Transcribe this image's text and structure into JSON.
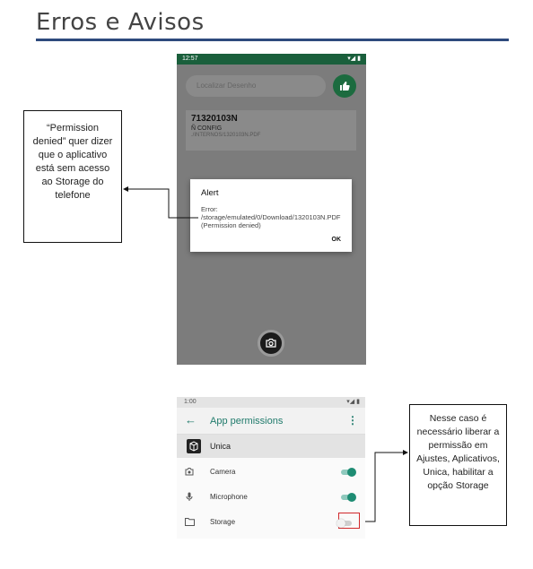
{
  "page": {
    "title": "Erros e Avisos"
  },
  "screen1": {
    "status_time": "12:57",
    "status_icons": "▾◢ ▮",
    "search_placeholder": "Localizar Desenho",
    "like_icon": "thumbs-up-icon",
    "card": {
      "code": "71320103N",
      "subtitle": "Ñ CONFIG",
      "path": "./INTERNOS/1320103N.PDF"
    },
    "alert": {
      "title": "Alert",
      "message": "Error: /storage/emulated/0/Download/1320103N.PDF (Permission denied)",
      "ok_label": "OK"
    },
    "camera_icon": "camera-icon"
  },
  "callout1": {
    "text": "“Permission denied” quer dizer que o aplicativo está sem acesso ao Storage do telefone"
  },
  "screen2": {
    "status_time": "1:00",
    "status_icons": "▾◢ ▮",
    "appbar_title": "App permissions",
    "app_name": "Unica",
    "permissions": [
      {
        "label": "Camera",
        "icon": "camera-icon",
        "enabled": true
      },
      {
        "label": "Microphone",
        "icon": "microphone-icon",
        "enabled": true
      },
      {
        "label": "Storage",
        "icon": "folder-icon",
        "enabled": false
      }
    ],
    "accent": "#1e8c73",
    "highlight_color": "#d0282b"
  },
  "callout2": {
    "text": "Nesse caso é necessário liberar a permissão em Ajustes, Aplicativos, Unica, habilitar a opção Storage"
  }
}
